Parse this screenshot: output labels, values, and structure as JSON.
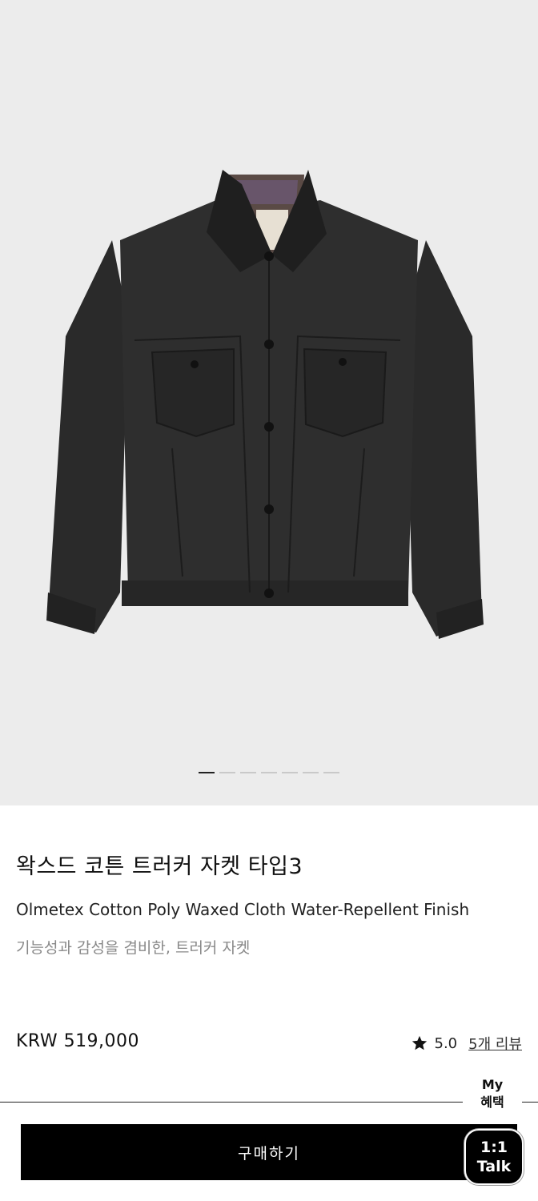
{
  "gallery": {
    "image_alt": "Black waxed trucker jacket",
    "total_images": 7,
    "active_index": 0
  },
  "product": {
    "title": "왁스드 코튼 트러커 자켓 타입3",
    "subtitle": "Olmetex Cotton Poly Waxed Cloth Water-Repellent Finish",
    "description": "기능성과 감성을 겸비한, 트러커 자켓",
    "price": "KRW 519,000",
    "rating": "5.0",
    "review_link": "5개 리뷰"
  },
  "floating": {
    "my_benefit_line1": "My",
    "my_benefit_line2": "혜택",
    "talk_line1": "1:1",
    "talk_line2": "Talk"
  },
  "actions": {
    "buy_label": "구매하기"
  },
  "icons": {
    "star": "star-icon"
  },
  "colors": {
    "hero_bg": "#ececec",
    "button_bg": "#000000",
    "muted_text": "#888888"
  }
}
